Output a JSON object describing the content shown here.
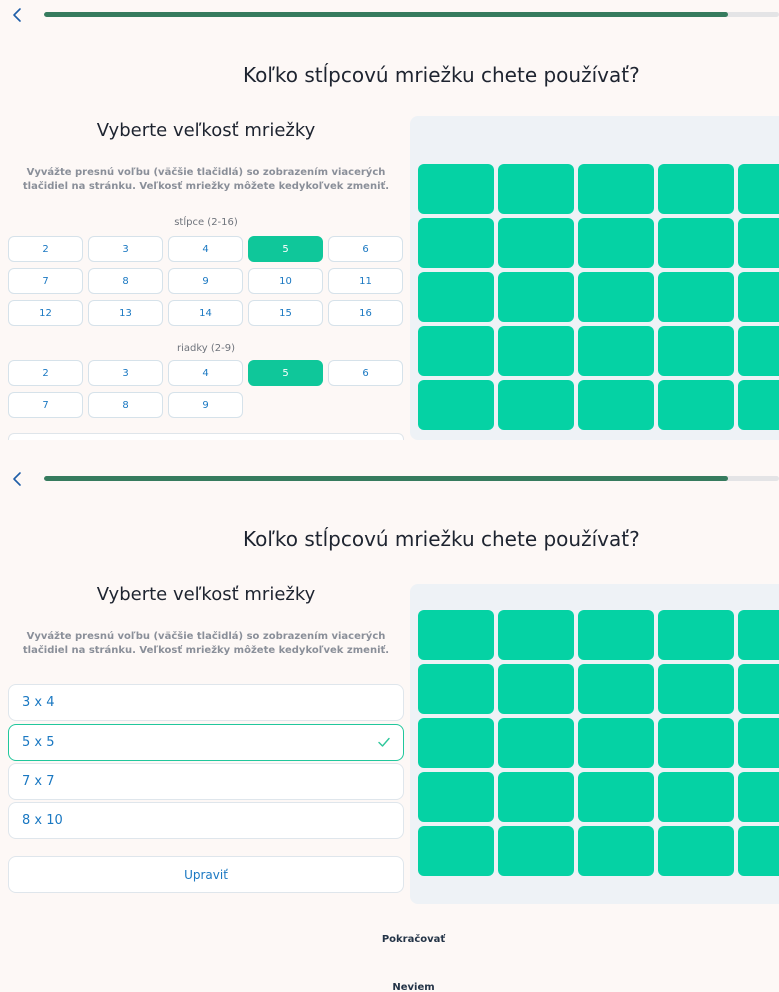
{
  "progress": {
    "value": 0.93
  },
  "colors": {
    "accent": "#05d2a4",
    "progress": "#367b5e",
    "link": "#1a78c2"
  },
  "icons": {
    "back": "chevron-left-icon",
    "check": "check-icon"
  },
  "panel1": {
    "title": "Koľko stĺpcovú mriežku chete používať?",
    "subtitle": "Vyberte veľkosť mriežky",
    "description": "Vyvážte presnú voľbu (väčšie tlačidlá) so zobrazením viacerých tlačidiel na stránku. Veľkosť mriežky môžete kedykoľvek zmeniť.",
    "columns_label": "stĺpce (2-16)",
    "columns": [
      "2",
      "3",
      "4",
      "5",
      "6",
      "7",
      "8",
      "9",
      "10",
      "11",
      "12",
      "13",
      "14",
      "15",
      "16"
    ],
    "columns_selected": "5",
    "rows_label": "riadky (2-9)",
    "rows": [
      "2",
      "3",
      "4",
      "5",
      "6",
      "7",
      "8",
      "9"
    ],
    "rows_selected": "5",
    "preview": {
      "columns": 5,
      "rows": 5
    }
  },
  "panel2": {
    "title": "Koľko stĺpcovú mriežku chete používať?",
    "subtitle": "Vyberte veľkosť mriežky",
    "description": "Vyvážte presnú voľbu (väčšie tlačidlá) so zobrazením viacerých tlačidiel na stránku. Veľkosť mriežky môžete kedykoľvek zmeniť.",
    "options": [
      "3 x 4",
      "5 x 5",
      "7 x 7",
      "8 x 10"
    ],
    "selected_option": "5 x 5",
    "edit_label": "Upraviť",
    "continue_label": "Pokračovať",
    "dont_know_label": "Neviem",
    "preview": {
      "columns": 5,
      "rows": 5
    }
  }
}
